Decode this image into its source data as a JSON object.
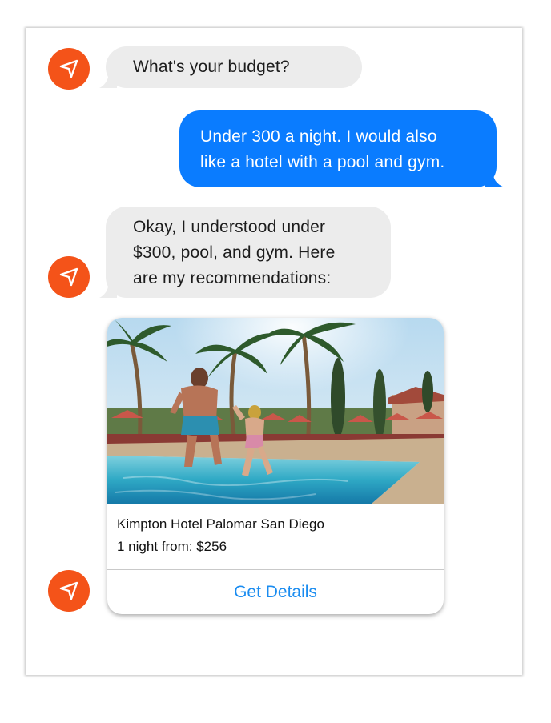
{
  "conversation": {
    "bot_question": "What's your budget?",
    "user_reply": "Under 300 a night. I would also\nlike a hotel with a pool and gym.",
    "bot_response": "Okay, I understood under\n$300, pool, and gym. Here\nare my recommendations:"
  },
  "hotel_card": {
    "name": "Kimpton Hotel Palomar San Diego",
    "price": "1 night from: $256",
    "action_label": "Get Details",
    "image_icon": "pool-photo"
  },
  "bot_icon": "paper-plane-icon",
  "colors": {
    "bot_avatar": "#f45319",
    "user_bubble": "#0a7cff",
    "bot_bubble": "#ececec",
    "link": "#1a8cf0"
  }
}
